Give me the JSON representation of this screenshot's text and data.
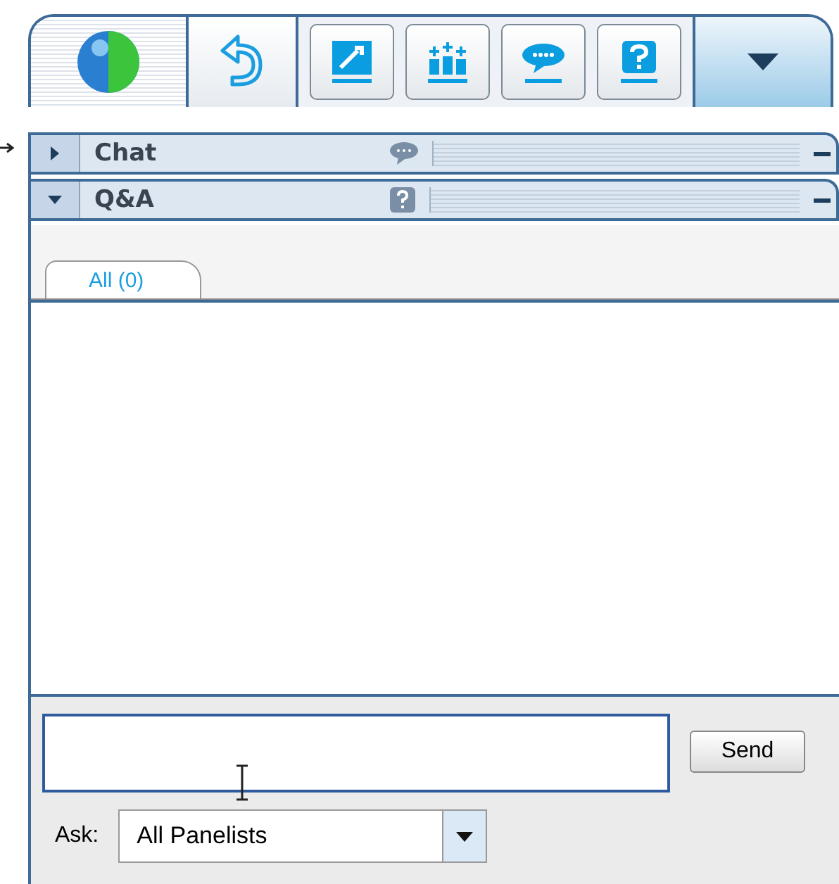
{
  "panels": [
    {
      "title": "Chat",
      "kind": "chat",
      "expanded": false
    },
    {
      "title": "Q&A",
      "kind": "help",
      "expanded": true
    }
  ],
  "tabs": [
    {
      "label": "All (0)",
      "selected": true
    }
  ],
  "compose": {
    "send_button": "Send",
    "ask_label": "Ask:",
    "ask_value": "All Panelists"
  }
}
